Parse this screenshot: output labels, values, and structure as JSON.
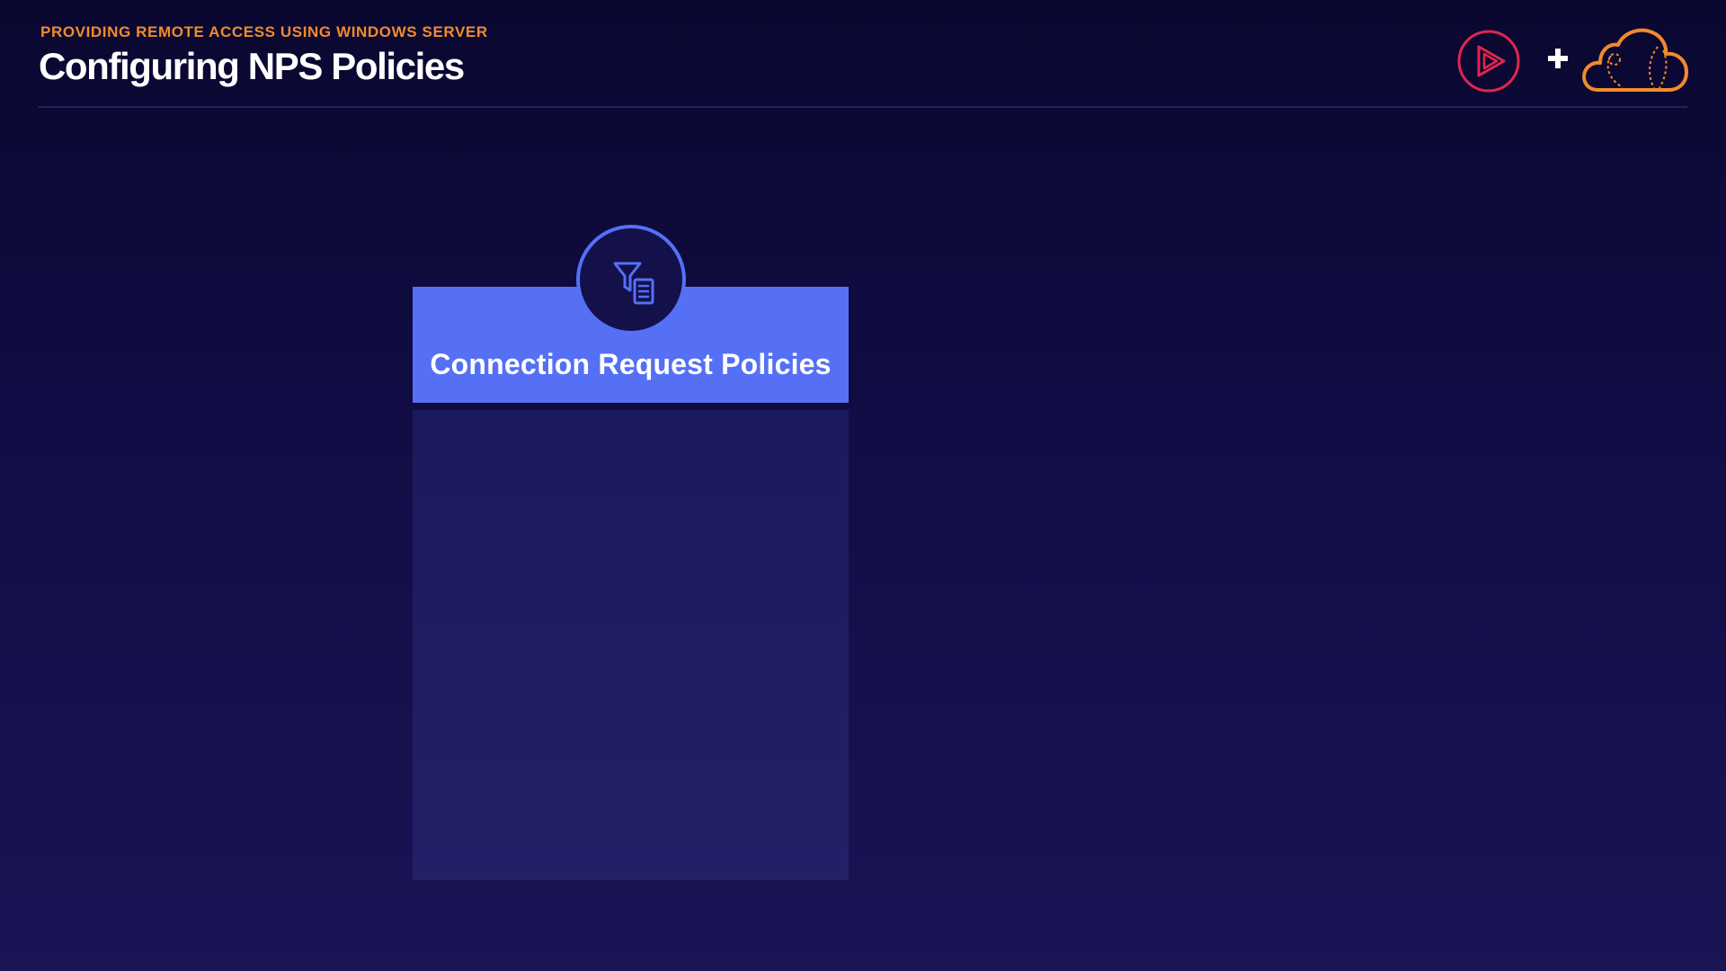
{
  "header": {
    "eyebrow": "PROVIDING REMOTE ACCESS USING WINDOWS SERVER",
    "title": "Configuring NPS Policies"
  },
  "brand": {
    "icons": [
      "play-logo-icon",
      "plus-icon",
      "cloud-logo-icon"
    ],
    "colors": {
      "play": "#e0264f",
      "plus": "#ffffff",
      "cloud": "#f28b2b"
    }
  },
  "card": {
    "title": "Connection Request Policies",
    "icon": "filter-document-icon",
    "colors": {
      "header": "#5570f5",
      "body": "#1f1c62",
      "badge_fill": "#14104a",
      "badge_ring": "#5570f5"
    }
  },
  "theme": {
    "background_top": "#0a0730",
    "background_bottom": "#1b1455",
    "accent": "#f28b2b"
  }
}
